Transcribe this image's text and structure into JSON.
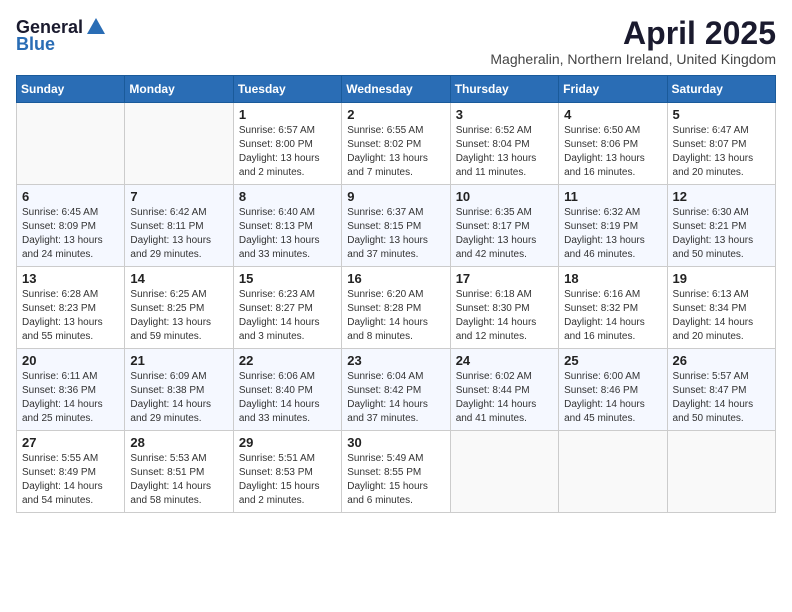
{
  "logo": {
    "general": "General",
    "blue": "Blue"
  },
  "title": "April 2025",
  "subtitle": "Magheralin, Northern Ireland, United Kingdom",
  "days_of_week": [
    "Sunday",
    "Monday",
    "Tuesday",
    "Wednesday",
    "Thursday",
    "Friday",
    "Saturday"
  ],
  "weeks": [
    [
      {
        "day": "",
        "info": ""
      },
      {
        "day": "",
        "info": ""
      },
      {
        "day": "1",
        "info": "Sunrise: 6:57 AM\nSunset: 8:00 PM\nDaylight: 13 hours and 2 minutes."
      },
      {
        "day": "2",
        "info": "Sunrise: 6:55 AM\nSunset: 8:02 PM\nDaylight: 13 hours and 7 minutes."
      },
      {
        "day": "3",
        "info": "Sunrise: 6:52 AM\nSunset: 8:04 PM\nDaylight: 13 hours and 11 minutes."
      },
      {
        "day": "4",
        "info": "Sunrise: 6:50 AM\nSunset: 8:06 PM\nDaylight: 13 hours and 16 minutes."
      },
      {
        "day": "5",
        "info": "Sunrise: 6:47 AM\nSunset: 8:07 PM\nDaylight: 13 hours and 20 minutes."
      }
    ],
    [
      {
        "day": "6",
        "info": "Sunrise: 6:45 AM\nSunset: 8:09 PM\nDaylight: 13 hours and 24 minutes."
      },
      {
        "day": "7",
        "info": "Sunrise: 6:42 AM\nSunset: 8:11 PM\nDaylight: 13 hours and 29 minutes."
      },
      {
        "day": "8",
        "info": "Sunrise: 6:40 AM\nSunset: 8:13 PM\nDaylight: 13 hours and 33 minutes."
      },
      {
        "day": "9",
        "info": "Sunrise: 6:37 AM\nSunset: 8:15 PM\nDaylight: 13 hours and 37 minutes."
      },
      {
        "day": "10",
        "info": "Sunrise: 6:35 AM\nSunset: 8:17 PM\nDaylight: 13 hours and 42 minutes."
      },
      {
        "day": "11",
        "info": "Sunrise: 6:32 AM\nSunset: 8:19 PM\nDaylight: 13 hours and 46 minutes."
      },
      {
        "day": "12",
        "info": "Sunrise: 6:30 AM\nSunset: 8:21 PM\nDaylight: 13 hours and 50 minutes."
      }
    ],
    [
      {
        "day": "13",
        "info": "Sunrise: 6:28 AM\nSunset: 8:23 PM\nDaylight: 13 hours and 55 minutes."
      },
      {
        "day": "14",
        "info": "Sunrise: 6:25 AM\nSunset: 8:25 PM\nDaylight: 13 hours and 59 minutes."
      },
      {
        "day": "15",
        "info": "Sunrise: 6:23 AM\nSunset: 8:27 PM\nDaylight: 14 hours and 3 minutes."
      },
      {
        "day": "16",
        "info": "Sunrise: 6:20 AM\nSunset: 8:28 PM\nDaylight: 14 hours and 8 minutes."
      },
      {
        "day": "17",
        "info": "Sunrise: 6:18 AM\nSunset: 8:30 PM\nDaylight: 14 hours and 12 minutes."
      },
      {
        "day": "18",
        "info": "Sunrise: 6:16 AM\nSunset: 8:32 PM\nDaylight: 14 hours and 16 minutes."
      },
      {
        "day": "19",
        "info": "Sunrise: 6:13 AM\nSunset: 8:34 PM\nDaylight: 14 hours and 20 minutes."
      }
    ],
    [
      {
        "day": "20",
        "info": "Sunrise: 6:11 AM\nSunset: 8:36 PM\nDaylight: 14 hours and 25 minutes."
      },
      {
        "day": "21",
        "info": "Sunrise: 6:09 AM\nSunset: 8:38 PM\nDaylight: 14 hours and 29 minutes."
      },
      {
        "day": "22",
        "info": "Sunrise: 6:06 AM\nSunset: 8:40 PM\nDaylight: 14 hours and 33 minutes."
      },
      {
        "day": "23",
        "info": "Sunrise: 6:04 AM\nSunset: 8:42 PM\nDaylight: 14 hours and 37 minutes."
      },
      {
        "day": "24",
        "info": "Sunrise: 6:02 AM\nSunset: 8:44 PM\nDaylight: 14 hours and 41 minutes."
      },
      {
        "day": "25",
        "info": "Sunrise: 6:00 AM\nSunset: 8:46 PM\nDaylight: 14 hours and 45 minutes."
      },
      {
        "day": "26",
        "info": "Sunrise: 5:57 AM\nSunset: 8:47 PM\nDaylight: 14 hours and 50 minutes."
      }
    ],
    [
      {
        "day": "27",
        "info": "Sunrise: 5:55 AM\nSunset: 8:49 PM\nDaylight: 14 hours and 54 minutes."
      },
      {
        "day": "28",
        "info": "Sunrise: 5:53 AM\nSunset: 8:51 PM\nDaylight: 14 hours and 58 minutes."
      },
      {
        "day": "29",
        "info": "Sunrise: 5:51 AM\nSunset: 8:53 PM\nDaylight: 15 hours and 2 minutes."
      },
      {
        "day": "30",
        "info": "Sunrise: 5:49 AM\nSunset: 8:55 PM\nDaylight: 15 hours and 6 minutes."
      },
      {
        "day": "",
        "info": ""
      },
      {
        "day": "",
        "info": ""
      },
      {
        "day": "",
        "info": ""
      }
    ]
  ]
}
